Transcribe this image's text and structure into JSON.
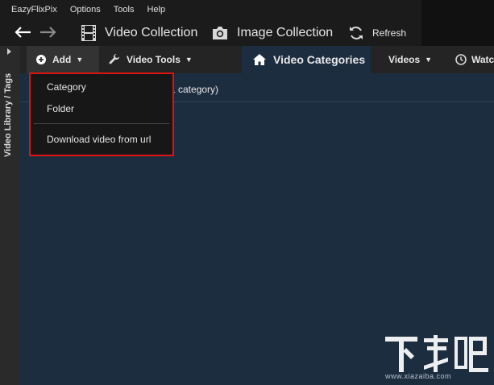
{
  "app": {
    "title": "EazyFlixPix"
  },
  "menubar": {
    "items": [
      "EazyFlixPix",
      "Options",
      "Tools",
      "Help"
    ]
  },
  "navbar": {
    "back_icon": "arrow-left-icon",
    "forward_icon": "arrow-right-icon",
    "video_collection_label": "Video Collection",
    "image_collection_label": "Image Collection",
    "refresh_label": "Refresh"
  },
  "sidebar": {
    "label": "Video Library / Tags"
  },
  "toolbar": {
    "add_label": "Add",
    "video_tools_label": "Video Tools",
    "video_categories_label": "Video Categories",
    "videos_label": "Videos",
    "watch_label": "Watc"
  },
  "content": {
    "header_text": "1 category)"
  },
  "add_menu": {
    "items": [
      "Category",
      "Folder",
      "Download video from url"
    ],
    "highlight_color": "#e01212"
  },
  "watermark": {
    "url": "www.xiazaiba.com"
  },
  "colors": {
    "content_bg": "#1d2d40",
    "toolbar_bg": "#242424",
    "titlebar_bg": "#1b1b1b"
  }
}
